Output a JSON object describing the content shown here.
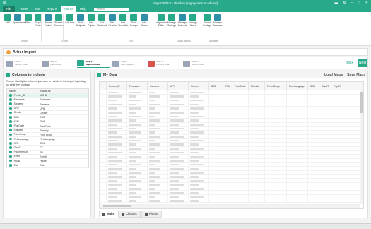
{
  "window": {
    "title": "Import Editor - Wisdom [Highgarden Academy]"
  },
  "menu": {
    "file": "File",
    "home": "Home",
    "ims": "IMS",
    "reports": "Reports",
    "admin": "Admin",
    "help": "Help",
    "search_placeholder": "Search"
  },
  "ribbon": {
    "buttons": [
      "MIS",
      "Spreadsheet",
      "Files",
      "Pupil Photos",
      "Wonde Fusion",
      "Share & Compare",
      "Edit Sets",
      "Edit Subjects",
      "Edit Pupils",
      "Edit Markbook",
      "Edit Results",
      "Edit Timetable",
      "Edit Groups",
      "Edit Grade",
      "Alignment Editor",
      "Manage Settings",
      "Manage Subjects",
      "Manage Users",
      "School Settings",
      "Manage Database"
    ],
    "groups": [
      "Import",
      "Export",
      "Edit",
      "Data Options",
      "Manage"
    ]
  },
  "banner": {
    "title": "Arbor Import"
  },
  "steps": [
    {
      "sub": "Step 1",
      "label": "Identify Data"
    },
    {
      "sub": "Step 2",
      "label": "Import Data"
    },
    {
      "sub": "Step 3",
      "label": "Map Columns"
    },
    {
      "sub": "Step 4",
      "label": "Map Subjects"
    },
    {
      "sub": "Step 5",
      "label": "Preview Data"
    },
    {
      "sub": "Step 6",
      "label": "Match Pupils"
    }
  ],
  "nav": {
    "back": "Back",
    "next": "Next"
  },
  "left": {
    "title": "Columns to Include",
    "instructions": "Please identify the columns you wish to include in this import by telling us what they contain.",
    "col_name": "Name",
    "col_include": "Include As",
    "rows": [
      {
        "name": "Person_ID",
        "include": "MIS ID"
      },
      {
        "name": "Forename",
        "include": "Forename"
      },
      {
        "name": "Surname",
        "include": "Surname"
      },
      {
        "name": "UPN",
        "include": "UPN"
      },
      {
        "name": "Gender",
        "include": "Gender"
      },
      {
        "name": "DOB",
        "include": "DOB"
      },
      {
        "name": "FSM",
        "include": "FSM"
      },
      {
        "name": "PostCode",
        "include": "Post Code"
      },
      {
        "name": "Ethnicity",
        "include": "Ethnicity"
      },
      {
        "name": "FormGroup",
        "include": "Form Group"
      },
      {
        "name": "FirstLanguage",
        "include": "First Language"
      },
      {
        "name": "SEN",
        "include": "SEN"
      },
      {
        "name": "GandT",
        "include": "GT"
      },
      {
        "name": "PupilPremium",
        "include": "PP"
      },
      {
        "name": "Event",
        "include": "Ever 6"
      },
      {
        "name": "House",
        "include": "House"
      },
      {
        "name": "EAL",
        "include": "EAL"
      }
    ]
  },
  "right": {
    "title": "My Data",
    "actions": [
      "Load Maps",
      "Save Maps"
    ],
    "columns": [
      "Person_ID",
      "Forename",
      "Surname",
      "UPN",
      "Gender",
      "DOB",
      "FSM",
      "Post Code",
      "Ethnicity",
      "Form Group",
      "First Language",
      "SEN",
      "GandT",
      "PupilPr"
    ]
  },
  "tabs": [
    {
      "label": "Main"
    },
    {
      "label": "Classes"
    },
    {
      "label": "Photos"
    }
  ]
}
